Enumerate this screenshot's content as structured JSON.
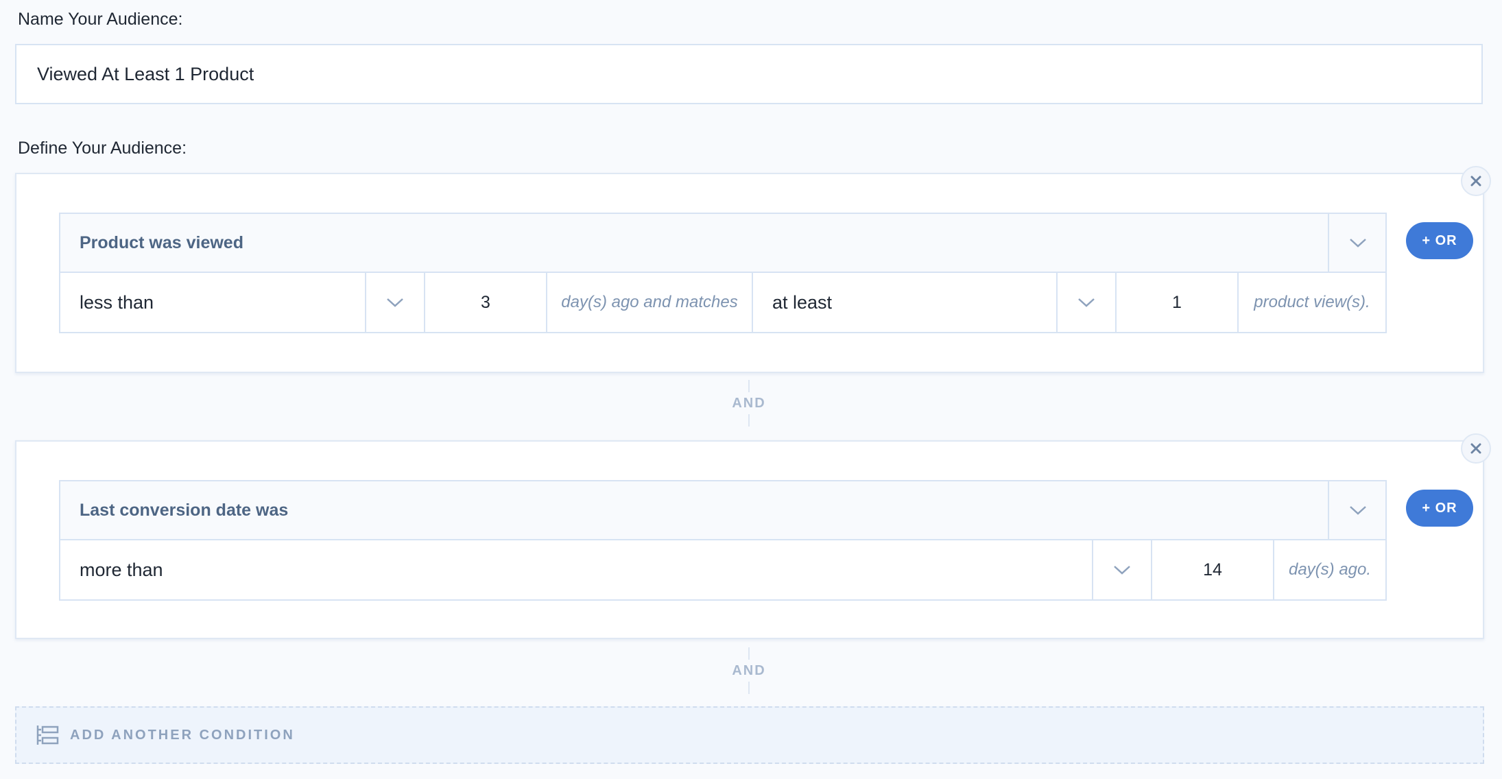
{
  "name_section": {
    "label": "Name Your Audience:",
    "value": "Viewed At Least 1 Product"
  },
  "define_section": {
    "label": "Define Your Audience:"
  },
  "conditions": [
    {
      "title": "Product was viewed",
      "operator": "less than",
      "days": "3",
      "days_suffix": "day(s) ago and matches",
      "count_operator": "at least",
      "count": "1",
      "count_suffix": "product view(s).",
      "or_label": "+ OR"
    },
    {
      "title": "Last conversion date was",
      "operator": "more than",
      "days": "14",
      "days_suffix": "day(s) ago.",
      "or_label": "+ OR"
    }
  ],
  "and_label": "AND",
  "add_condition_label": "ADD ANOTHER CONDITION",
  "colors": {
    "accent": "#3f7ad8",
    "border": "#d7e3f3",
    "muted_text": "#7d93b0"
  },
  "icons": {
    "close": "close-icon",
    "caret": "chevron-down-icon",
    "add_condition": "add-condition-icon"
  }
}
